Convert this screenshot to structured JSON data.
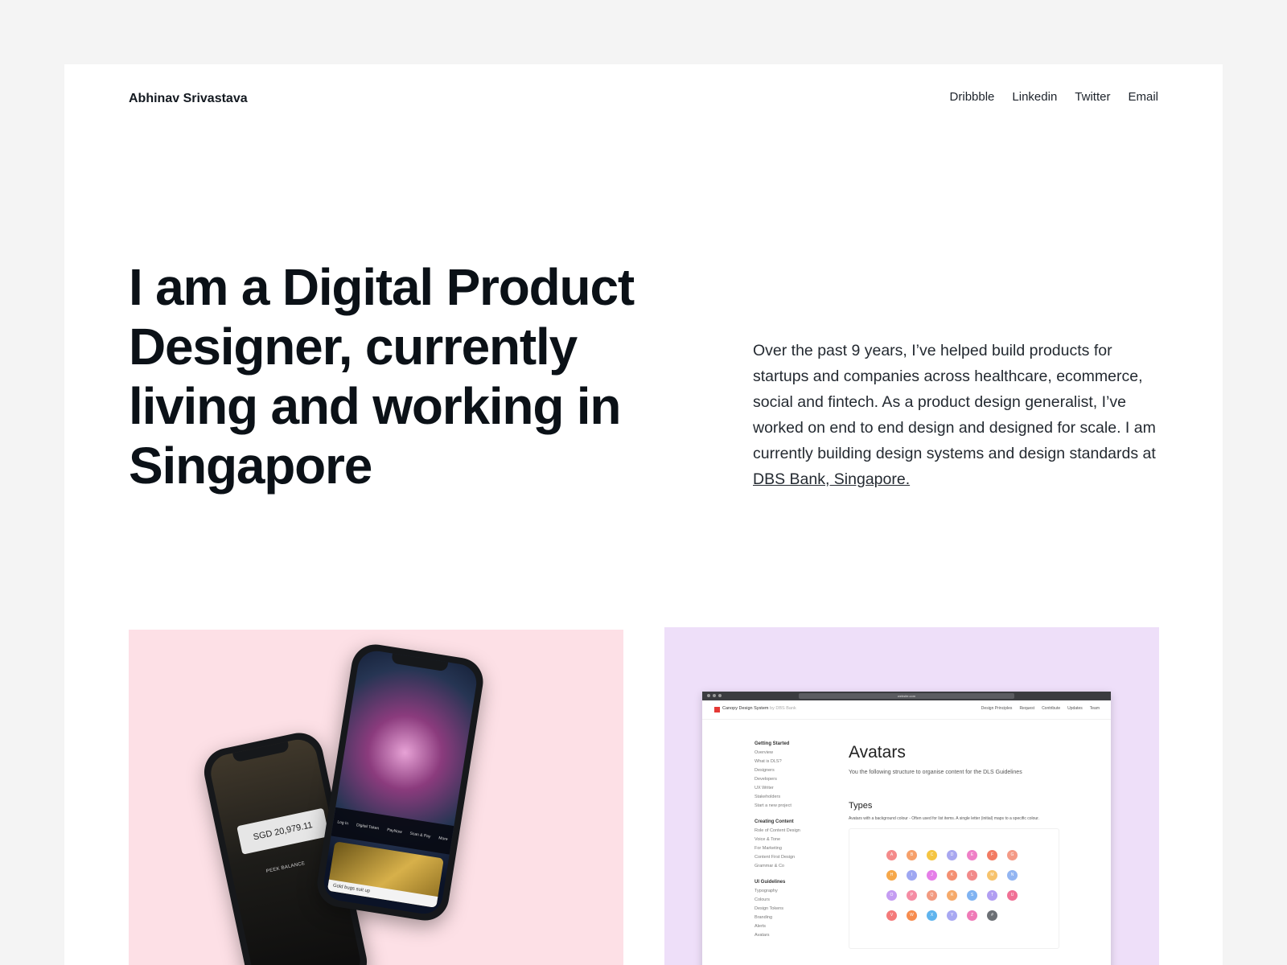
{
  "header": {
    "site_name": "Abhinav Srivastava",
    "nav": [
      {
        "label": "Dribbble"
      },
      {
        "label": "Linkedin"
      },
      {
        "label": "Twitter"
      },
      {
        "label": "Email"
      }
    ]
  },
  "hero": {
    "headline": "I am a Digital Product Designer, currently living and working in Singapore",
    "intro_text": "Over the past 9 years, I’ve helped build products for startups and companies across healthcare, ecommerce, social and fintech. As a product design generalist, I’ve worked on end to end design and designed for scale. I am currently building design systems and design standards at ",
    "intro_link": "DBS Bank, Singapore."
  },
  "projects": {
    "phone_mock": {
      "balance": "SGD 20,979.11",
      "peek_label": "PEEK BALANCE",
      "tabs": [
        "Log In",
        "Digital Token",
        "PayNow",
        "Scan & Pay",
        "More"
      ],
      "story_caption": "Gold bugs suit up"
    },
    "browser_mock": {
      "url": "website.com",
      "brand": "Canopy Design System",
      "brand_sub": "by DBS Bank",
      "menu": [
        "Design Principles",
        "Request",
        "Contribute",
        "Updates",
        "Team"
      ],
      "sidebar": [
        {
          "section": "Getting Started",
          "items": [
            "Overview",
            "What is DLS?",
            "Designers",
            "Developers",
            "UX Writer",
            "Stakeholders",
            "Start a new project"
          ]
        },
        {
          "section": "Creating Content",
          "items": [
            "Role of Content Design",
            "Voice & Tone",
            "For Marketing",
            "Content First Design",
            "Grammar & Co"
          ]
        },
        {
          "section": "UI Guidelines",
          "items": [
            "Typography",
            "Colours",
            "Design Tokens",
            "Branding",
            "Alerts",
            "Avatars"
          ]
        }
      ],
      "page_title": "Avatars",
      "page_subtitle": "You the following structure to organise content for the DLS Guidelines",
      "types_heading": "Types",
      "types_desc": "Avatars with a background colour - Often used for list items. A single letter (initial) maps to a specific colour.",
      "avatars": [
        {
          "letter": "A",
          "color": "#f48a8a"
        },
        {
          "letter": "B",
          "color": "#f6a06a"
        },
        {
          "letter": "C",
          "color": "#f5c542"
        },
        {
          "letter": "D",
          "color": "#a8a7f0"
        },
        {
          "letter": "E",
          "color": "#ef7fc7"
        },
        {
          "letter": "F",
          "color": "#f27b63"
        },
        {
          "letter": "G",
          "color": "#f49a86"
        },
        {
          "letter": "H",
          "color": "#f6a84a"
        },
        {
          "letter": "I",
          "color": "#9ea7f2"
        },
        {
          "letter": "J",
          "color": "#e57ee8"
        },
        {
          "letter": "K",
          "color": "#f49072"
        },
        {
          "letter": "L",
          "color": "#f28a8a"
        },
        {
          "letter": "M",
          "color": "#f7c36c"
        },
        {
          "letter": "N",
          "color": "#92b5f2"
        },
        {
          "letter": "O",
          "color": "#c49cf2"
        },
        {
          "letter": "P",
          "color": "#f58ca4"
        },
        {
          "letter": "Q",
          "color": "#f29a80"
        },
        {
          "letter": "R",
          "color": "#f6aa6a"
        },
        {
          "letter": "S",
          "color": "#7fb3f2"
        },
        {
          "letter": "T",
          "color": "#b19ef2"
        },
        {
          "letter": "U",
          "color": "#f07095"
        },
        {
          "letter": "V",
          "color": "#f47a7a"
        },
        {
          "letter": "W",
          "color": "#f78c4e"
        },
        {
          "letter": "X",
          "color": "#5fb4ee"
        },
        {
          "letter": "Y",
          "color": "#a8a8f2"
        },
        {
          "letter": "Z",
          "color": "#ef7ab7"
        },
        {
          "letter": "#",
          "color": "#6c7075"
        }
      ]
    }
  },
  "colors": {
    "page_bg": "#f4f4f4",
    "card_pink": "#fde0e6",
    "card_lavender": "#eedff9",
    "text": "#0b1117"
  }
}
